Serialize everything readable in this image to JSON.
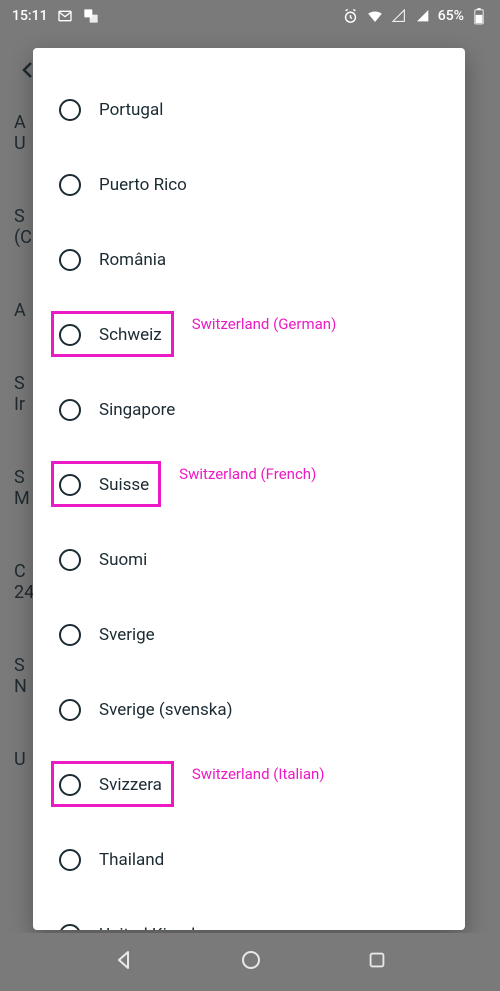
{
  "status": {
    "time": "15:11",
    "battery_pct": "65%"
  },
  "background": {
    "groups": [
      {
        "title": "A",
        "sub": "U"
      },
      {
        "title": "S",
        "sub": "(C"
      },
      {
        "title": "A",
        "sub": ""
      },
      {
        "title": "S",
        "sub": "Ir"
      },
      {
        "title": "S",
        "sub": "M"
      },
      {
        "title": "C",
        "sub": "24"
      },
      {
        "title": "S",
        "sub": "N"
      },
      {
        "title": "U",
        "sub": ""
      }
    ]
  },
  "dialog": {
    "options": [
      {
        "label": "Portugal",
        "highlighted": false
      },
      {
        "label": "Puerto Rico",
        "highlighted": false
      },
      {
        "label": "România",
        "highlighted": false
      },
      {
        "label": "Schweiz",
        "highlighted": true,
        "annotation": "Switzerland (German)"
      },
      {
        "label": "Singapore",
        "highlighted": false
      },
      {
        "label": "Suisse",
        "highlighted": true,
        "annotation": "Switzerland (French)"
      },
      {
        "label": "Suomi",
        "highlighted": false
      },
      {
        "label": "Sverige",
        "highlighted": false
      },
      {
        "label": "Sverige (svenska)",
        "highlighted": false
      },
      {
        "label": "Svizzera",
        "highlighted": true,
        "annotation": "Switzerland (Italian)"
      },
      {
        "label": "Thailand",
        "highlighted": false
      },
      {
        "label": "United Kingdom",
        "highlighted": false
      }
    ]
  },
  "annotation_color": "#ec1ac4"
}
